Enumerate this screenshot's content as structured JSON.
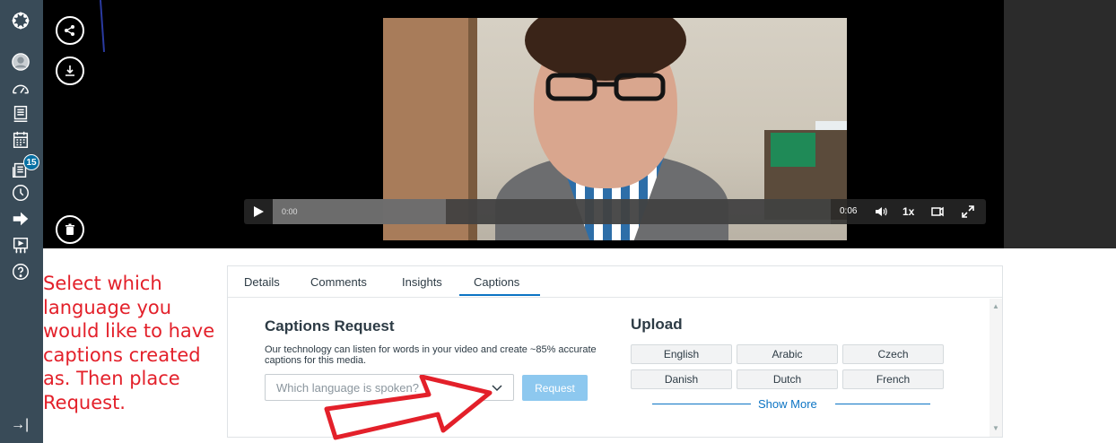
{
  "nav": {
    "items": [
      {
        "name": "logo-icon"
      },
      {
        "name": "account-icon"
      },
      {
        "name": "dashboard-icon"
      },
      {
        "name": "courses-icon"
      },
      {
        "name": "calendar-icon"
      },
      {
        "name": "inbox-icon"
      },
      {
        "name": "history-icon"
      },
      {
        "name": "commons-icon"
      },
      {
        "name": "studio-icon"
      },
      {
        "name": "help-icon"
      }
    ],
    "inbox_badge": "15",
    "collapse_glyph": "→|"
  },
  "player": {
    "current_time": "0:00",
    "duration": "0:06",
    "speed": "1x",
    "progress_fraction": 0.31
  },
  "tabs": [
    {
      "label": "Details"
    },
    {
      "label": "Comments"
    },
    {
      "label": "Insights"
    },
    {
      "label": "Captions",
      "active": true
    }
  ],
  "captions": {
    "title": "Captions Request",
    "description": "Our technology can listen for words in your video and create ~85% accurate captions for this media.",
    "select_placeholder": "Which language is spoken?",
    "request_label": "Request"
  },
  "upload": {
    "title": "Upload",
    "languages": [
      "English",
      "Arabic",
      "Czech",
      "Danish",
      "Dutch",
      "French"
    ],
    "show_more": "Show More"
  },
  "annotation": {
    "lines": [
      "Select which",
      "language you",
      "would like to have",
      "captions created",
      "as. Then place",
      "Request."
    ]
  },
  "colors": {
    "nav_bg": "#394b58",
    "accent": "#0c74c4",
    "request_button": "#8dc8ef",
    "annotation_red": "#e3202a"
  }
}
